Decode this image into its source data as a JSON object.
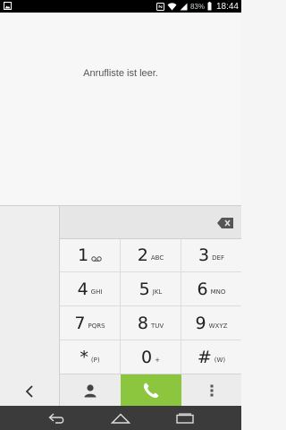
{
  "status_bar": {
    "battery_percent": "83%",
    "time": "18:44",
    "icons": [
      "image-notification-icon",
      "nfc-icon",
      "wifi-icon",
      "signal-icon",
      "battery-icon"
    ]
  },
  "call_log": {
    "empty_message": "Anrufliste ist leer."
  },
  "keypad": {
    "keys": [
      {
        "digit": "1",
        "letters": "",
        "icon": "voicemail-icon"
      },
      {
        "digit": "2",
        "letters": "ABC"
      },
      {
        "digit": "3",
        "letters": "DEF"
      },
      {
        "digit": "4",
        "letters": "GHI"
      },
      {
        "digit": "5",
        "letters": "JKL"
      },
      {
        "digit": "6",
        "letters": "MNO"
      },
      {
        "digit": "7",
        "letters": "PQRS"
      },
      {
        "digit": "8",
        "letters": "TUV"
      },
      {
        "digit": "9",
        "letters": "WXYZ"
      },
      {
        "digit": "*",
        "letters": "(P)"
      },
      {
        "digit": "0",
        "letters": "+"
      },
      {
        "digit": "#",
        "letters": "(W)"
      }
    ]
  },
  "actions": {
    "contacts_icon": "person-icon",
    "call_icon": "phone-icon",
    "menu_icon": "overflow-menu-icon",
    "call_color": "#8cc63f"
  },
  "nav": {
    "back_icon": "back-icon",
    "home_icon": "home-icon",
    "recents_icon": "recents-icon"
  }
}
